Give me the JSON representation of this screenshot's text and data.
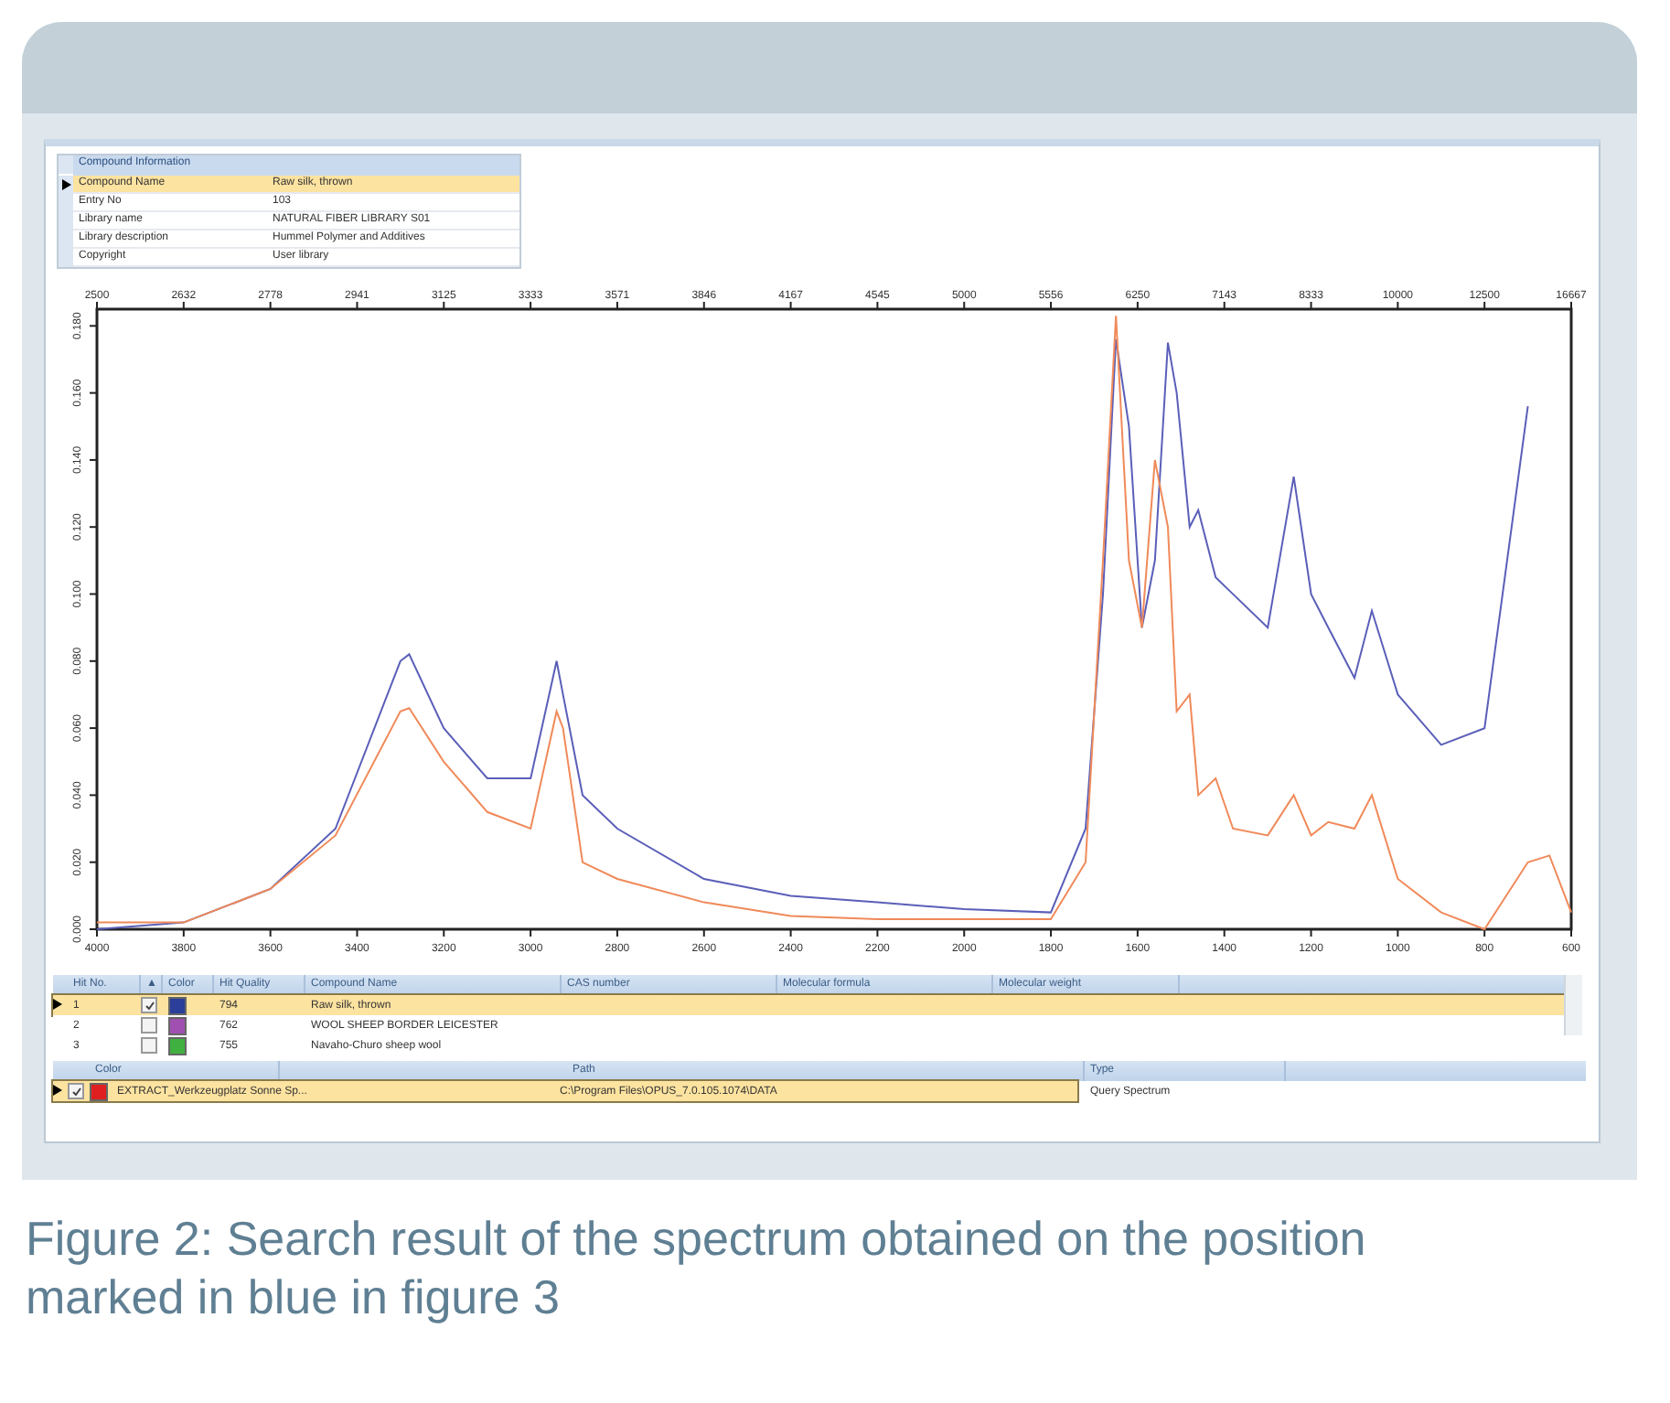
{
  "compound_info": {
    "header": "Compound Information",
    "rows": [
      {
        "label": "Compound Name",
        "value": "Raw silk, thrown",
        "selected": true
      },
      {
        "label": "Entry No",
        "value": "103",
        "selected": false
      },
      {
        "label": "Library name",
        "value": "NATURAL FIBER LIBRARY S01",
        "selected": false
      },
      {
        "label": "Library description",
        "value": "Hummel Polymer and Additives",
        "selected": false
      },
      {
        "label": "Copyright",
        "value": "User library",
        "selected": false
      }
    ]
  },
  "spectrum": {
    "top_xticks": [
      "2500",
      "2632",
      "2778",
      "2941",
      "3125",
      "3333",
      "3571",
      "3846",
      "4167",
      "4545",
      "5000",
      "5556",
      "6250",
      "7143",
      "8333",
      "10000",
      "12500",
      "16667"
    ],
    "chart_data": {
      "type": "line",
      "x": [
        4000,
        3800,
        3600,
        3450,
        3300,
        3280,
        3200,
        3100,
        3000,
        2940,
        2925,
        2880,
        2800,
        2600,
        2400,
        2200,
        2000,
        1800,
        1720,
        1680,
        1650,
        1620,
        1590,
        1560,
        1530,
        1510,
        1480,
        1460,
        1420,
        1380,
        1300,
        1240,
        1200,
        1160,
        1100,
        1060,
        1000,
        900,
        800,
        700,
        650,
        600
      ],
      "series": [
        {
          "color": "#5a5fb8",
          "values": [
            0.0,
            0.002,
            0.012,
            0.03,
            0.08,
            0.082,
            0.06,
            0.045,
            0.045,
            0.08,
            0.07,
            0.04,
            0.03,
            0.015,
            0.01,
            0.008,
            0.006,
            0.005,
            0.03,
            0.1,
            0.176,
            0.15,
            0.09,
            0.11,
            0.175,
            0.16,
            0.12,
            0.125,
            0.105,
            0.1,
            0.09,
            0.135,
            0.1,
            0.09,
            0.075,
            0.095,
            0.07,
            0.055,
            0.06,
            0.156,
            null,
            null
          ]
        },
        {
          "color": "#f08a5a",
          "values": [
            0.002,
            0.002,
            0.012,
            0.028,
            0.065,
            0.066,
            0.05,
            0.035,
            0.03,
            0.065,
            0.06,
            0.02,
            0.015,
            0.008,
            0.004,
            0.003,
            0.003,
            0.003,
            0.02,
            0.11,
            0.183,
            0.11,
            0.09,
            0.14,
            0.12,
            0.065,
            0.07,
            0.04,
            0.045,
            0.03,
            0.028,
            0.04,
            0.028,
            0.032,
            0.03,
            0.04,
            0.015,
            0.005,
            0.0,
            0.02,
            0.022,
            0.005
          ]
        }
      ],
      "xlim": [
        4000,
        600
      ],
      "ylim": [
        0,
        0.185
      ],
      "xticks": [
        4000,
        3800,
        3600,
        3400,
        3200,
        3000,
        2800,
        2600,
        2400,
        2200,
        2000,
        1800,
        1600,
        1400,
        1200,
        1000,
        800,
        600
      ],
      "yticks": [
        {
          "value": 0,
          "label": "0.000"
        },
        {
          "value": 0.02,
          "label": "0.020"
        },
        {
          "value": 0.04,
          "label": "0.040"
        },
        {
          "value": 0.06,
          "label": "0.060"
        },
        {
          "value": 0.08,
          "label": "0.080"
        },
        {
          "value": 0.1,
          "label": "0.100"
        },
        {
          "value": 0.12,
          "label": "0.120"
        },
        {
          "value": 0.14,
          "label": "0.140"
        },
        {
          "value": 0.16,
          "label": "0.160"
        },
        {
          "value": 0.18,
          "label": "0.180"
        }
      ]
    }
  },
  "hits": {
    "columns": [
      "Hit No.",
      "▲",
      "Color",
      "Hit Quality",
      "Compound Name",
      "CAS number",
      "Molecular formula",
      "Molecular weight"
    ],
    "rows": [
      {
        "hit_no": "1",
        "checked": true,
        "color": "#2a3e9a",
        "quality": "794",
        "name": "Raw silk, thrown",
        "selected": true
      },
      {
        "hit_no": "2",
        "checked": false,
        "color": "#a050b0",
        "quality": "762",
        "name": "WOOL SHEEP BORDER LEICESTER",
        "selected": false
      },
      {
        "hit_no": "3",
        "checked": false,
        "color": "#40b040",
        "quality": "755",
        "name": "Navaho-Churo sheep wool",
        "selected": false
      }
    ]
  },
  "query": {
    "columns": [
      "Color",
      "Path",
      "Type"
    ],
    "rows": [
      {
        "checked": true,
        "color": "#e02020",
        "name": "EXTRACT_Werkzeugplatz Sonne Sp...",
        "path": "C:\\Program Files\\OPUS_7.0.105.1074\\DATA",
        "type": "Query Spectrum",
        "selected": true
      }
    ]
  },
  "caption": "Figure 2: Search result of the spectrum obtained on the position marked in blue in figure 3"
}
